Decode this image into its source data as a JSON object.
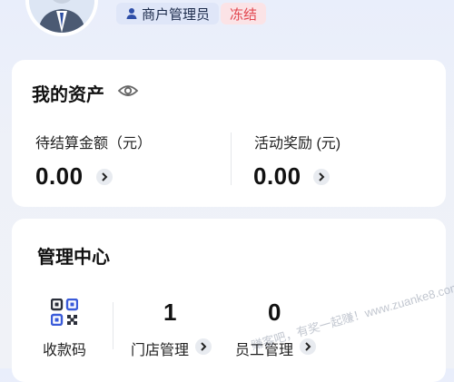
{
  "header": {
    "role_badge": "商户管理员",
    "status_badge": "冻结"
  },
  "assets": {
    "title": "我的资产",
    "pending_label": "待结算金额（元）",
    "pending_value": "0.00",
    "reward_label": "活动奖励 (元)",
    "reward_value": "0.00"
  },
  "management": {
    "title": "管理中心",
    "qr_label": "收款码",
    "store_count": "1",
    "store_label": "门店管理",
    "staff_count": "0",
    "staff_label": "员工管理"
  },
  "watermark": "赚客吧，有奖一起赚！www.zuanke8.com",
  "colors": {
    "accent": "#1b2a4a",
    "frozen": "#e2464f",
    "qr_blue": "#3a5bd9"
  }
}
